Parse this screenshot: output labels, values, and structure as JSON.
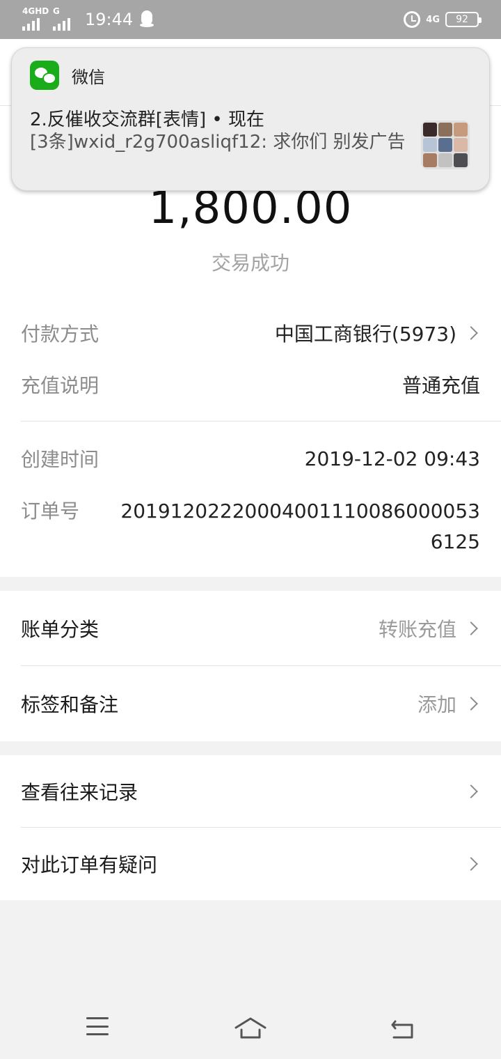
{
  "status_bar": {
    "sim1_tag": "4GHD",
    "sim2_tag": "G",
    "time": "19:44",
    "network": "4G",
    "battery": "92"
  },
  "notification": {
    "app_name": "微信",
    "title": "2.反催收交流群[表情] • 现在",
    "body": "[3条]wxid_r2g700asliqf12: 求你们 别发广告"
  },
  "transaction": {
    "amount": "1,800.00",
    "status": "交易成功"
  },
  "details": {
    "payment_method_label": "付款方式",
    "payment_method_value": "中国工商银行(5973)",
    "recharge_note_label": "充值说明",
    "recharge_note_value": "普通充值",
    "created_time_label": "创建时间",
    "created_time_value": "2019-12-02 09:43",
    "order_no_label": "订单号",
    "order_no_value": "2019120222000400111008600005361​25"
  },
  "categories": {
    "bill_category_label": "账单分类",
    "bill_category_value": "转账充值",
    "tags_label": "标签和备注",
    "tags_value": "添加"
  },
  "actions": {
    "history_label": "查看往来记录",
    "question_label": "对此订单有疑问"
  }
}
